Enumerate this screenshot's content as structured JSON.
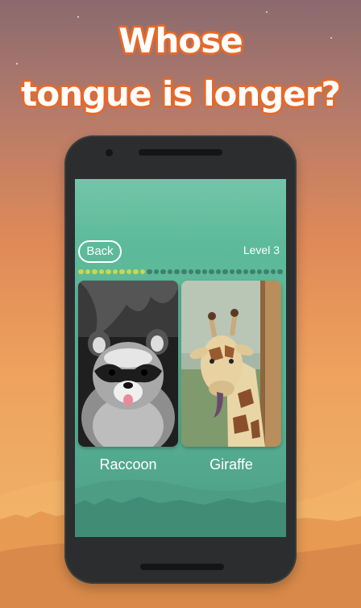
{
  "promo": {
    "headline_line1": "Whose",
    "headline_line2": "tongue is longer?"
  },
  "game": {
    "back_label": "Back",
    "level_label": "Level 3",
    "progress": {
      "completed": 10,
      "total": 30
    },
    "choices": [
      {
        "name": "Raccoon",
        "image_icon": "raccoon-photo"
      },
      {
        "name": "Giraffe",
        "image_icon": "giraffe-photo"
      }
    ]
  },
  "colors": {
    "accent_outline": "#e6692a",
    "screen_bg": "#5fbd9c",
    "progress_done": "#c9d84a",
    "progress_todo": "#3f7f6b"
  }
}
